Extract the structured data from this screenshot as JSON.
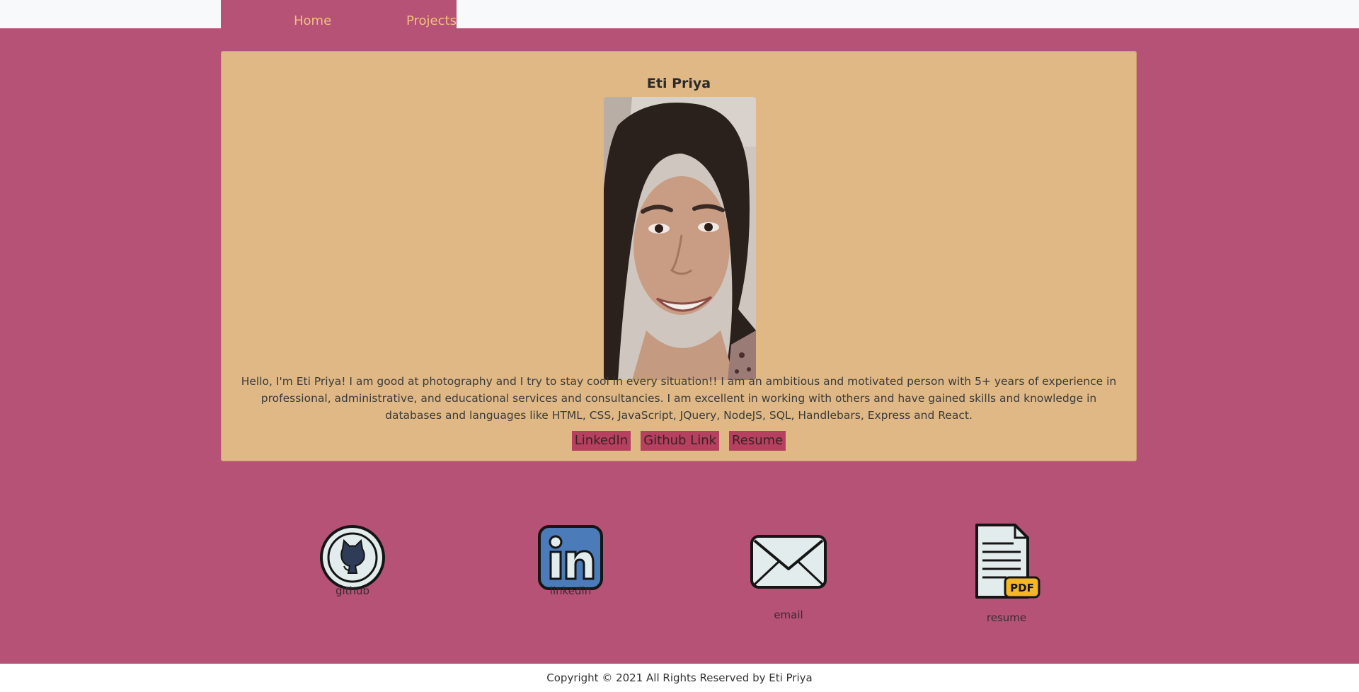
{
  "nav": {
    "home": "Home",
    "projects": "Projects"
  },
  "profile": {
    "name": "Eti Priya",
    "bio": "Hello, I'm Eti Priya! I am good at photography and I try to stay cool in every situation!! I am an ambitious and motivated person with 5+ years of experience in professional, administrative, and educational services and consultancies. I am excellent in working with others and have gained skills and knowledge in databases and languages like HTML, CSS, JavaScript, JQuery, NodeJS, SQL, Handlebars, Express and React.",
    "links": {
      "linkedin": "LinkedIn",
      "github": "Github Link",
      "resume": "Resume"
    }
  },
  "icons": {
    "github": "github",
    "linkedin": "linkedin",
    "email": "email",
    "resume": "resume"
  },
  "footer": {
    "text": "Copyright © 2021 All Rights Reserved by Eti Priya"
  },
  "colors": {
    "background": "#b55275",
    "card": "#dfb885",
    "nav_text": "#f0c27b",
    "button": "#b5405f"
  }
}
